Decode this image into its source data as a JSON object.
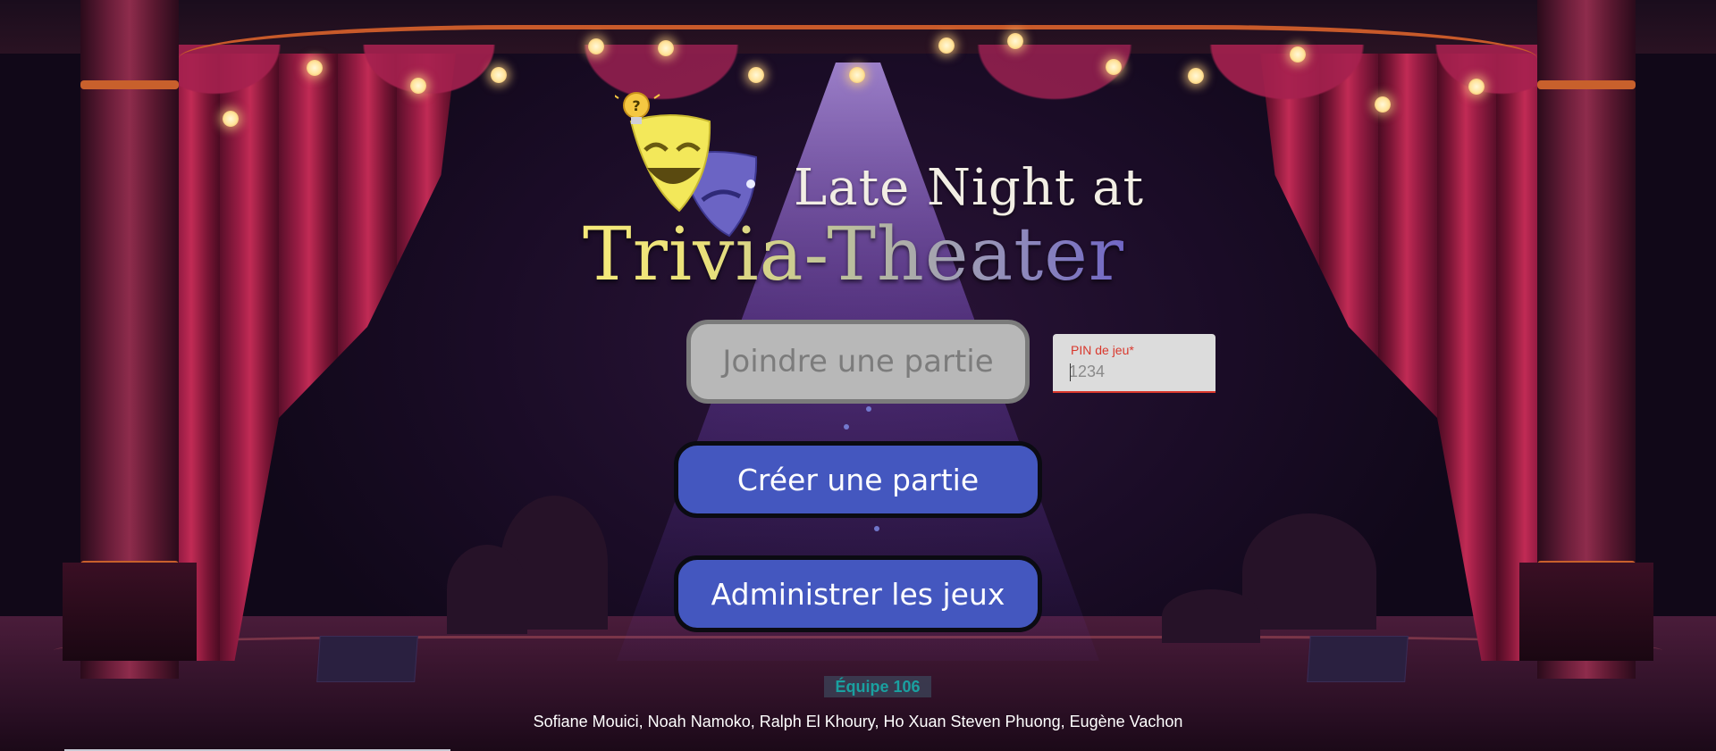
{
  "app": {
    "title_line1": "Late Night at",
    "title_line2": "Trivia-Theater"
  },
  "home": {
    "join_label": "Joindre une partie",
    "pin": {
      "label": "PIN de jeu*",
      "placeholder": "1234",
      "value": ""
    },
    "create_label": "Créer une partie",
    "admin_label": "Administrer les jeux"
  },
  "footer": {
    "team": "Équipe 106",
    "members": "Sofiane Mouici, Noah Namoko, Ralph El Khoury, Ho Xuan Steven Phuong, Eugène Vachon"
  },
  "colors": {
    "primary_button": "#4457bf",
    "join_button": "#b8b8b8",
    "error_red": "#d9382d",
    "team_teal": "#1aa0a0"
  },
  "icons": {
    "logo": "theater-masks-icon",
    "bulb": "lightbulb-question-icon"
  }
}
